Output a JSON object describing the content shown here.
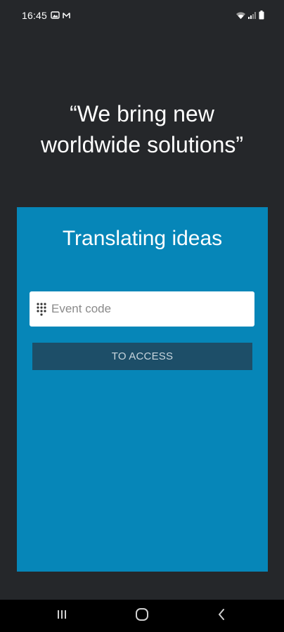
{
  "status_bar": {
    "time": "16:45",
    "left_icons": [
      "gallery-notification-icon",
      "mail-notification-icon"
    ],
    "right_icons": [
      "wifi-icon",
      "signal-icon",
      "battery-icon"
    ]
  },
  "quote": {
    "line1": "“We bring new",
    "line2": "worldwide solutions”"
  },
  "card": {
    "title": "Translating ideas",
    "event_code_placeholder": "Event code",
    "event_code_value": "",
    "access_button_label": "TO ACCESS",
    "background_color": "#0686b8",
    "button_color": "#1d4e68"
  },
  "nav_bar": {
    "buttons": [
      "recent-apps-icon",
      "home-icon",
      "back-icon"
    ]
  }
}
